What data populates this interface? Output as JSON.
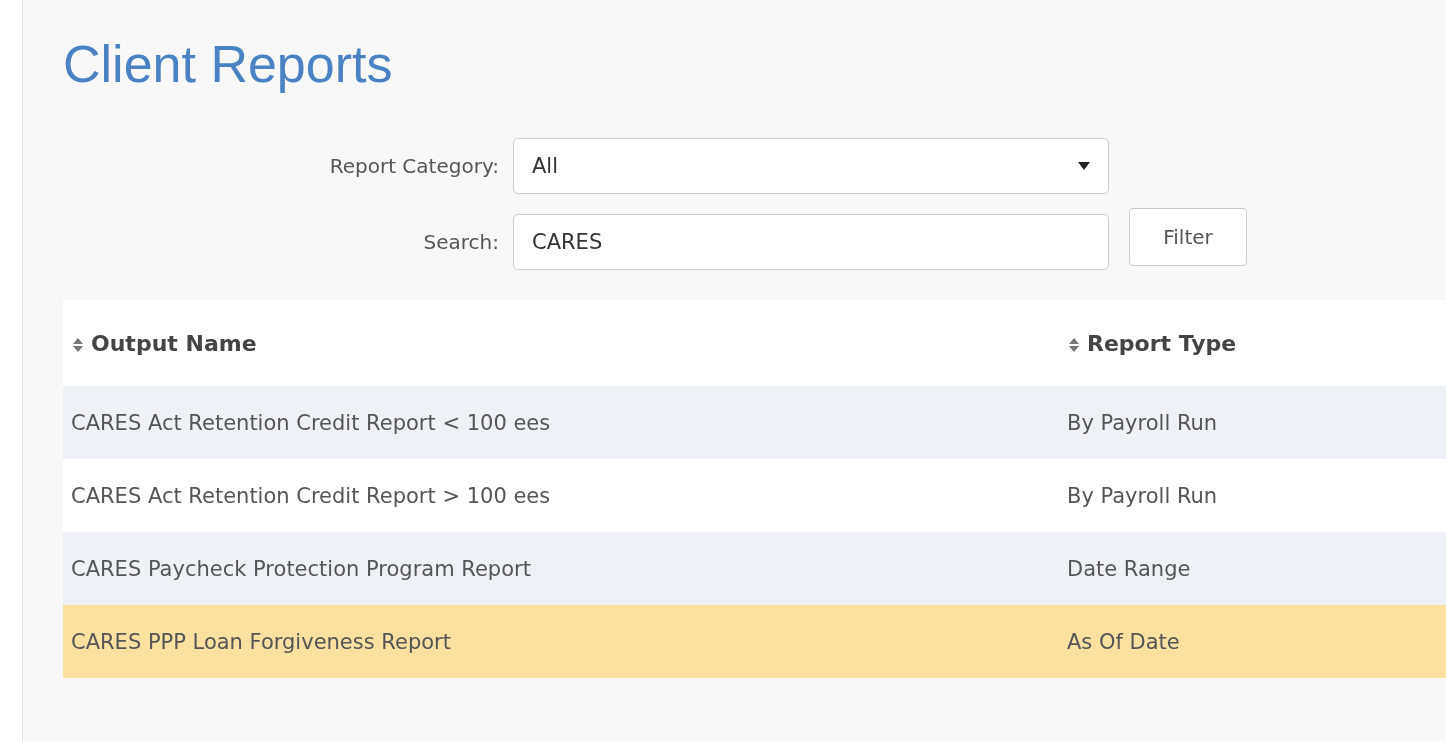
{
  "page_title": "Client Reports",
  "filters": [
    {
      "kind": "select",
      "label": "Report Category:",
      "value": "All"
    },
    {
      "kind": "text",
      "label": "Search:",
      "value": "CARES",
      "button": "Filter"
    }
  ],
  "table": {
    "columns": [
      "Output Name",
      "Report Type"
    ],
    "rows": [
      {
        "cells": [
          "CARES Act Retention Credit Report < 100 ees",
          "By Payroll Run"
        ],
        "selected": false
      },
      {
        "cells": [
          "CARES Act Retention Credit Report > 100 ees",
          "By Payroll Run"
        ],
        "selected": false
      },
      {
        "cells": [
          "CARES Paycheck Protection Program Report",
          "Date Range"
        ],
        "selected": false
      },
      {
        "cells": [
          "CARES PPP Loan Forgiveness Report",
          "As Of Date"
        ],
        "selected": true
      }
    ]
  }
}
